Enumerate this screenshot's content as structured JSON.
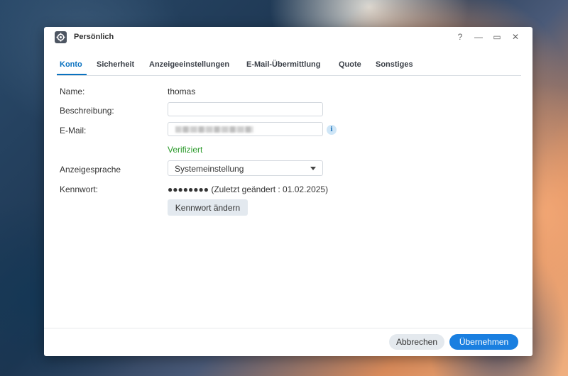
{
  "window": {
    "title": "Persönlich",
    "controls": {
      "help": "?",
      "minimize": "—",
      "maximize": "▭",
      "close": "✕"
    }
  },
  "tabs": [
    {
      "label": "Konto",
      "active": true
    },
    {
      "label": "Sicherheit",
      "active": false
    },
    {
      "label": "Anzeigeeinstellungen",
      "active": false
    },
    {
      "label": "E-Mail-Übermittlung",
      "active": false
    },
    {
      "label": "Quote",
      "active": false
    },
    {
      "label": "Sonstiges",
      "active": false
    }
  ],
  "form": {
    "name_label": "Name:",
    "name_value": "thomas",
    "description_label": "Beschreibung:",
    "description_value": "",
    "email_label": "E-Mail:",
    "email_status": "Verifiziert",
    "language_label": "Anzeigesprache",
    "language_value": "Systemeinstellung",
    "password_label": "Kennwort:",
    "password_value": "●●●●●●●● (Zuletzt geändert : 01.02.2025)",
    "change_password_button": "Kennwort ändern"
  },
  "footer": {
    "cancel_label": "Abbrechen",
    "apply_label": "Übernehmen"
  },
  "colors": {
    "accent": "#0a72c0",
    "primary_button": "#1a7fe0",
    "verified": "#2a9a2a"
  },
  "icons": {
    "app": "control-panel-gear-icon",
    "info": "info-icon",
    "dropdown": "chevron-down-icon"
  }
}
